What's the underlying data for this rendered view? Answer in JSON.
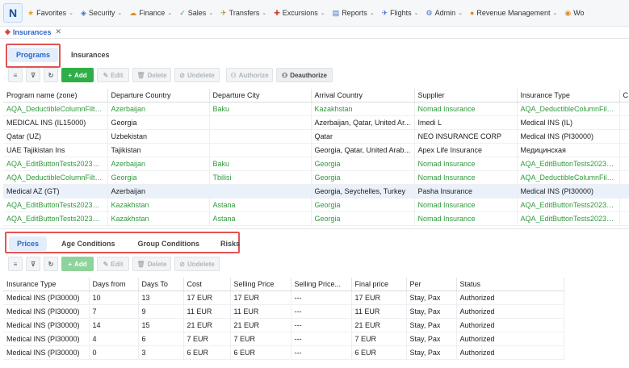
{
  "nav": {
    "items": [
      {
        "icon": "★",
        "label": "Favorites",
        "color": "#e8a317"
      },
      {
        "icon": "◈",
        "label": "Security",
        "color": "#3f6fd1"
      },
      {
        "icon": "☁",
        "label": "Finance",
        "color": "#e58b1c"
      },
      {
        "icon": "✓",
        "label": "Sales",
        "color": "#2fae48"
      },
      {
        "icon": "✈",
        "label": "Transfers",
        "color": "#b98a2d"
      },
      {
        "icon": "✚",
        "label": "Excursions",
        "color": "#d23f3f"
      },
      {
        "icon": "▤",
        "label": "Reports",
        "color": "#3f6fd1"
      },
      {
        "icon": "✈",
        "label": "Flights",
        "color": "#3f6fd1"
      },
      {
        "icon": "⚙",
        "label": "Admin",
        "color": "#3f6fd1"
      },
      {
        "icon": "●",
        "label": "Revenue Management",
        "color": "#e58b1c"
      },
      {
        "icon": "◉",
        "label": "Wo",
        "color": "#e58b1c"
      }
    ]
  },
  "doc_tab": {
    "label": "Insurances"
  },
  "upper_tabs": [
    {
      "label": "Programs"
    },
    {
      "label": "Insurances"
    }
  ],
  "upper_toolbar": {
    "add": "Add",
    "edit": "Edit",
    "delete": "Delete",
    "undelete": "Undelete",
    "authorize": "Authorize",
    "deauthorize": "Deauthorize"
  },
  "programs": {
    "columns": [
      "Program name (zone)",
      "Departure Country",
      "Departure City",
      "Arrival Country",
      "Supplier",
      "Insurance Type",
      "C"
    ],
    "rows": [
      {
        "style": "green",
        "cells": [
          "AQA_DeductibleColumnFilte...",
          "Azerbaijan",
          "Baku",
          "Kazakhstan",
          "Nomad Insurance",
          "AQA_DeductibleColumnFilte...",
          ""
        ]
      },
      {
        "style": "",
        "cells": [
          "MEDICAL INS (IL15000)",
          "Georgia",
          "",
          "Azerbaijan, Qatar, United Ar...",
          "Imedi L",
          "Medical INS (IL)",
          ""
        ]
      },
      {
        "style": "",
        "cells": [
          "Qatar (UZ)",
          "Uzbekistan",
          "",
          "Qatar",
          "NEO INSURANCE CORP",
          "Medical INS (PI30000)",
          ""
        ]
      },
      {
        "style": "",
        "cells": [
          "UAE Tajikistan Ins",
          "Tajikistan",
          "",
          "Georgia, Qatar, United Arab...",
          "Apex Life Insurance",
          "Медицинская",
          ""
        ]
      },
      {
        "style": "green",
        "cells": [
          "AQA_EditButtonTests202310...",
          "Azerbaijan",
          "Baku",
          "Georgia",
          "Nomad Insurance",
          "AQA_EditButtonTests202310...",
          ""
        ]
      },
      {
        "style": "green",
        "cells": [
          "AQA_DeductibleColumnFilte...",
          "Georgia",
          "Tbilisi",
          "Georgia",
          "Nomad Insurance",
          "AQA_DeductibleColumnFilte...",
          ""
        ]
      },
      {
        "style": "sel",
        "cells": [
          "Medical AZ (GT)",
          "Azerbaijan",
          "",
          "Georgia, Seychelles, Turkey",
          "Pasha Insurance",
          "Medical INS (PI30000)",
          ""
        ]
      },
      {
        "style": "green",
        "cells": [
          "AQA_EditButtonTests202310...",
          "Kazakhstan",
          "Astana",
          "Georgia",
          "Nomad Insurance",
          "AQA_EditButtonTests202310...",
          ""
        ]
      },
      {
        "style": "green",
        "cells": [
          "AQA_EditButtonTests202310...",
          "Kazakhstan",
          "Astana",
          "Georgia",
          "Nomad Insurance",
          "AQA_EditButtonTests202310...",
          ""
        ]
      }
    ]
  },
  "lower_tabs": [
    {
      "label": "Prices"
    },
    {
      "label": "Age Conditions"
    },
    {
      "label": "Group Conditions"
    },
    {
      "label": "Risks"
    }
  ],
  "lower_toolbar": {
    "add": "Add",
    "edit": "Edit",
    "delete": "Delete",
    "undelete": "Undelete"
  },
  "prices": {
    "columns": [
      "Insurance Type",
      "Days from",
      "Days To",
      "Cost",
      "Selling Price",
      "Selling Price...",
      "Final price",
      "Per",
      "Status"
    ],
    "rows": [
      [
        "Medical INS (PI30000)",
        "10",
        "13",
        "17 EUR",
        "17 EUR",
        "---",
        "17 EUR",
        "Stay, Pax",
        "Authorized"
      ],
      [
        "Medical INS (PI30000)",
        "7",
        "9",
        "11 EUR",
        "11 EUR",
        "---",
        "11 EUR",
        "Stay, Pax",
        "Authorized"
      ],
      [
        "Medical INS (PI30000)",
        "14",
        "15",
        "21 EUR",
        "21 EUR",
        "---",
        "21 EUR",
        "Stay, Pax",
        "Authorized"
      ],
      [
        "Medical INS (PI30000)",
        "4",
        "6",
        "7 EUR",
        "7 EUR",
        "---",
        "7 EUR",
        "Stay, Pax",
        "Authorized"
      ],
      [
        "Medical INS (PI30000)",
        "0",
        "3",
        "6 EUR",
        "6 EUR",
        "---",
        "6 EUR",
        "Stay, Pax",
        "Authorized"
      ]
    ]
  }
}
